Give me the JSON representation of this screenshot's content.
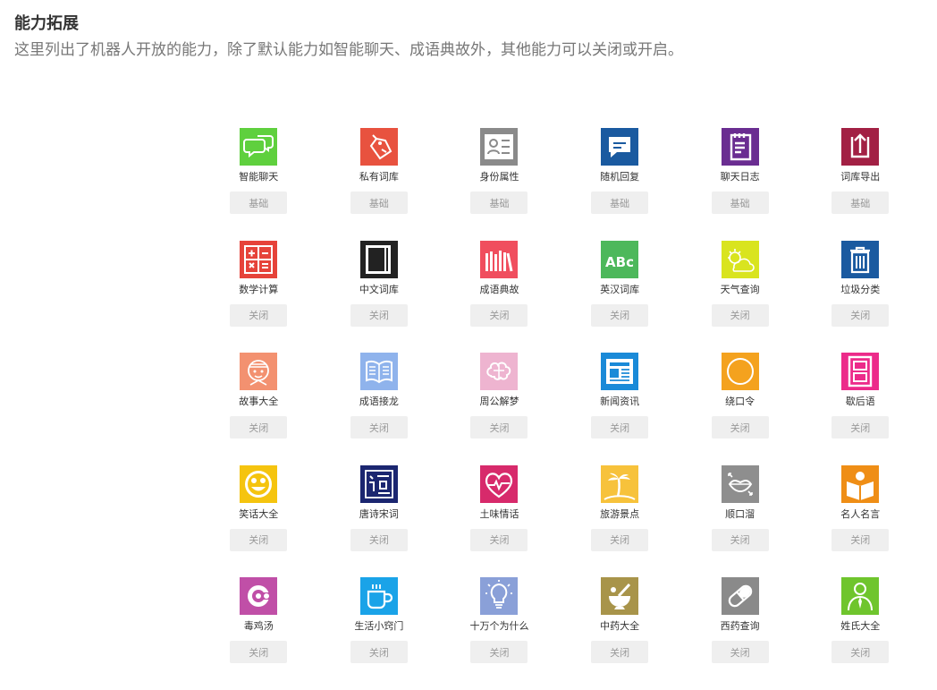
{
  "header": {
    "title": "能力拓展",
    "description": "这里列出了机器人开放的能力，除了默认能力如智能聊天、成语典故外，其他能力可以关闭或开启。"
  },
  "abilities": [
    {
      "name": "智能聊天",
      "status": "基础",
      "icon": "chat-bubbles-icon",
      "color": "#5fd03e"
    },
    {
      "name": "私有词库",
      "status": "基础",
      "icon": "tag-icon",
      "color": "#e8523f"
    },
    {
      "name": "身份属性",
      "status": "基础",
      "icon": "id-card-icon",
      "color": "#8a8a8a"
    },
    {
      "name": "随机回复",
      "status": "基础",
      "icon": "reply-bubble-icon",
      "color": "#1a5aa0"
    },
    {
      "name": "聊天日志",
      "status": "基础",
      "icon": "notepad-icon",
      "color": "#6a2d91"
    },
    {
      "name": "词库导出",
      "status": "基础",
      "icon": "export-arrow-icon",
      "color": "#a22044"
    },
    {
      "name": "数学计算",
      "status": "关闭",
      "icon": "calculator-icon",
      "color": "#e6433a"
    },
    {
      "name": "中文词库",
      "status": "关闭",
      "icon": "notebook-icon",
      "color": "#222222"
    },
    {
      "name": "成语典故",
      "status": "关闭",
      "icon": "books-icon",
      "color": "#f04e5e"
    },
    {
      "name": "英汉词库",
      "status": "关闭",
      "icon": "abc-icon",
      "color": "#4db85b"
    },
    {
      "name": "天气查询",
      "status": "关闭",
      "icon": "weather-icon",
      "color": "#d9e41f"
    },
    {
      "name": "垃圾分类",
      "status": "关闭",
      "icon": "trash-bin-icon",
      "color": "#1a5aa0"
    },
    {
      "name": "故事大全",
      "status": "关闭",
      "icon": "face-icon",
      "color": "#f39170"
    },
    {
      "name": "成语接龙",
      "status": "关闭",
      "icon": "open-book-icon",
      "color": "#8fb3ec"
    },
    {
      "name": "周公解梦",
      "status": "关闭",
      "icon": "brain-icon",
      "color": "#eeb4d0"
    },
    {
      "name": "新闻资讯",
      "status": "关闭",
      "icon": "newspaper-icon",
      "color": "#1a8ad8"
    },
    {
      "name": "绕口令",
      "status": "关闭",
      "icon": "circle-icon",
      "color": "#f4a21e"
    },
    {
      "name": "歇后语",
      "status": "关闭",
      "icon": "film-icon",
      "color": "#ec2b8a"
    },
    {
      "name": "笑话大全",
      "status": "关闭",
      "icon": "smiley-icon",
      "color": "#f5c40f"
    },
    {
      "name": "唐诗宋词",
      "status": "关闭",
      "icon": "poem-icon",
      "color": "#1b2670"
    },
    {
      "name": "土味情话",
      "status": "关闭",
      "icon": "heart-pulse-icon",
      "color": "#d72a6b"
    },
    {
      "name": "旅游景点",
      "status": "关闭",
      "icon": "palm-tree-icon",
      "color": "#f7c23b"
    },
    {
      "name": "顺口溜",
      "status": "关闭",
      "icon": "lips-icon",
      "color": "#8e8e8e"
    },
    {
      "name": "名人名言",
      "status": "关闭",
      "icon": "reader-icon",
      "color": "#ef8e16"
    },
    {
      "name": "毒鸡汤",
      "status": "关闭",
      "icon": "swirl-icon",
      "color": "#c04fa7"
    },
    {
      "name": "生活小窍门",
      "status": "关闭",
      "icon": "cup-icon",
      "color": "#1aa3e8"
    },
    {
      "name": "十万个为什么",
      "status": "关闭",
      "icon": "lightbulb-icon",
      "color": "#8aa0d8"
    },
    {
      "name": "中药大全",
      "status": "关闭",
      "icon": "mortar-icon",
      "color": "#a8944a"
    },
    {
      "name": "西药查询",
      "status": "关闭",
      "icon": "pill-icon",
      "color": "#8a8a8a"
    },
    {
      "name": "姓氏大全",
      "status": "关闭",
      "icon": "person-icon",
      "color": "#6fc52d"
    }
  ]
}
